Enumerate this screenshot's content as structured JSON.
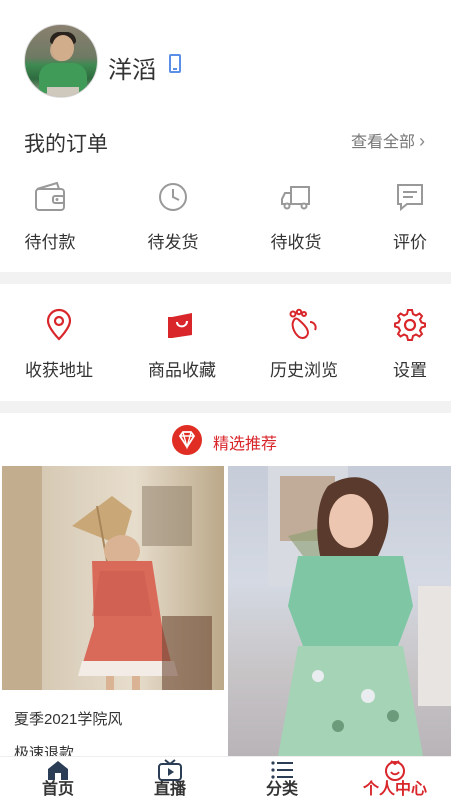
{
  "profile": {
    "username": "洋滔"
  },
  "orders": {
    "title": "我的订单",
    "view_all": "查看全部",
    "items": [
      {
        "label": "待付款",
        "icon": "wallet-icon"
      },
      {
        "label": "待发货",
        "icon": "clock-icon"
      },
      {
        "label": "待收货",
        "icon": "truck-icon"
      },
      {
        "label": "评价",
        "icon": "comment-icon"
      }
    ]
  },
  "services": {
    "items": [
      {
        "label": "收获地址",
        "icon": "location-pin-icon"
      },
      {
        "label": "商品收藏",
        "icon": "shopping-bag-icon"
      },
      {
        "label": "历史浏览",
        "icon": "footprint-icon"
      },
      {
        "label": "设置",
        "icon": "gear-icon"
      }
    ]
  },
  "recommend": {
    "title": "精选推荐",
    "icon": "diamond-icon"
  },
  "products": [
    {
      "title": "夏季2021学院风",
      "title2": "极速退款"
    },
    {
      "title": ""
    }
  ],
  "tabbar": {
    "items": [
      {
        "label": "首页",
        "icon": "home-icon"
      },
      {
        "label": "直播",
        "icon": "tv-icon"
      },
      {
        "label": "分类",
        "icon": "list-icon"
      },
      {
        "label": "个人中心",
        "icon": "user-center-icon"
      }
    ],
    "active_color": "#d8262b"
  },
  "colors": {
    "accent": "#d8262b",
    "phone_icon": "#5b8ee6",
    "gap": "#f2f2f2"
  }
}
